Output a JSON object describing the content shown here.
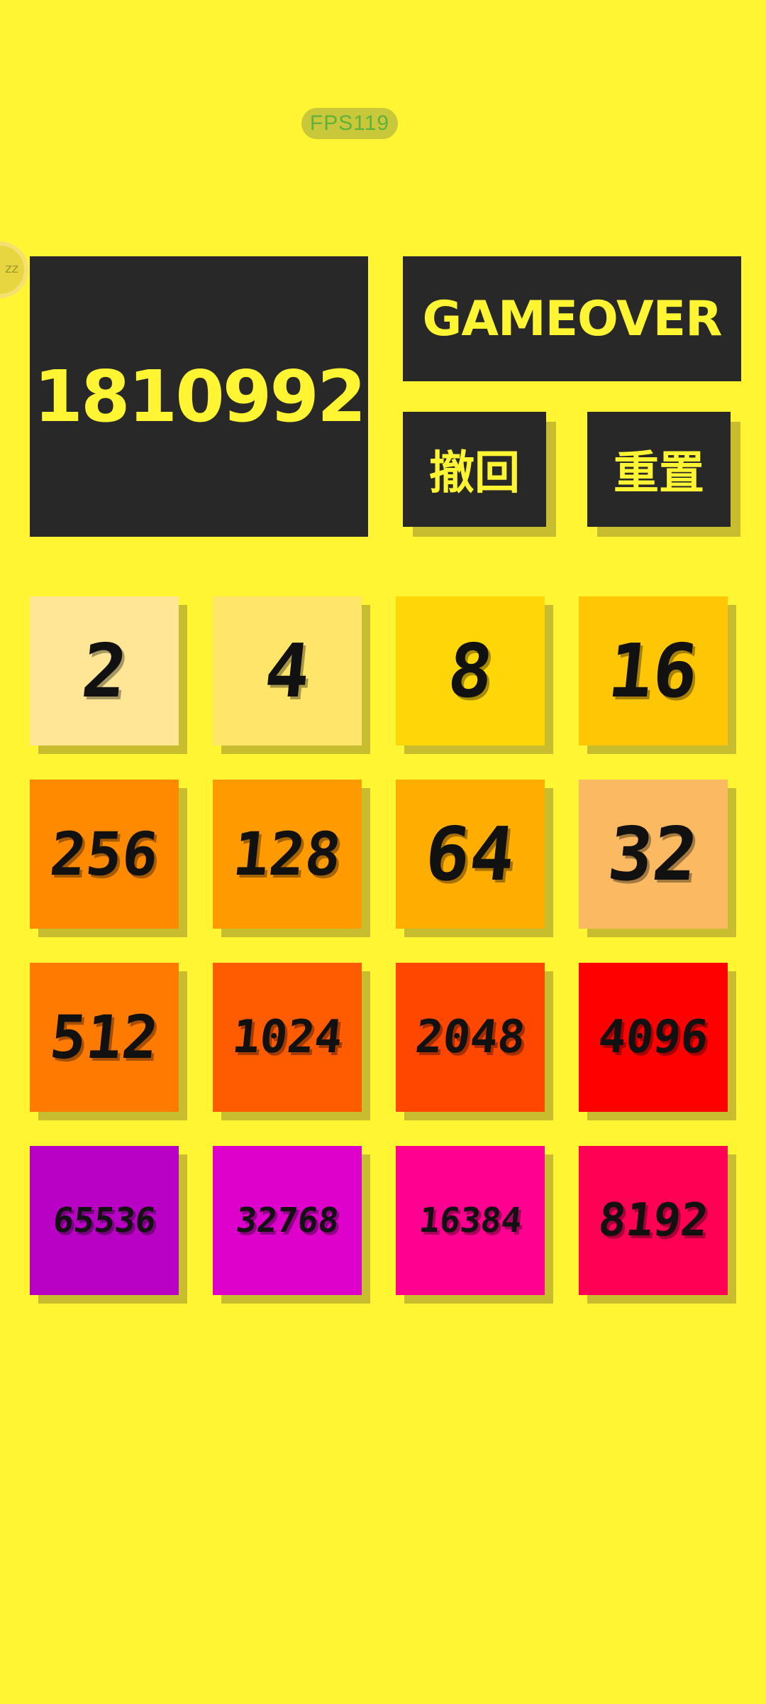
{
  "fps": "FPS119",
  "score": "1810992",
  "status": "GAMEOVER",
  "buttons": {
    "undo": "撤回",
    "reset": "重置"
  },
  "colors": {
    "background": "#FFF533",
    "panel": "#282828",
    "accent_text": "#FFF533",
    "shadow": "#C7BD2E"
  },
  "tiles": [
    {
      "value": "2",
      "color": "#FFE697"
    },
    {
      "value": "4",
      "color": "#FFE66B"
    },
    {
      "value": "8",
      "color": "#FFD709"
    },
    {
      "value": "16",
      "color": "#FFC606"
    },
    {
      "value": "256",
      "color": "#FF8A00"
    },
    {
      "value": "128",
      "color": "#FF9A00"
    },
    {
      "value": "64",
      "color": "#FFAE00"
    },
    {
      "value": "32",
      "color": "#FBBA62"
    },
    {
      "value": "512",
      "color": "#FF7A00"
    },
    {
      "value": "1024",
      "color": "#FF5B00"
    },
    {
      "value": "2048",
      "color": "#FF4700"
    },
    {
      "value": "4096",
      "color": "#FF0000"
    },
    {
      "value": "65536",
      "color": "#B900C5"
    },
    {
      "value": "32768",
      "color": "#DE00CB"
    },
    {
      "value": "16384",
      "color": "#FF0090"
    },
    {
      "value": "8192",
      "color": "#FF0055"
    }
  ]
}
